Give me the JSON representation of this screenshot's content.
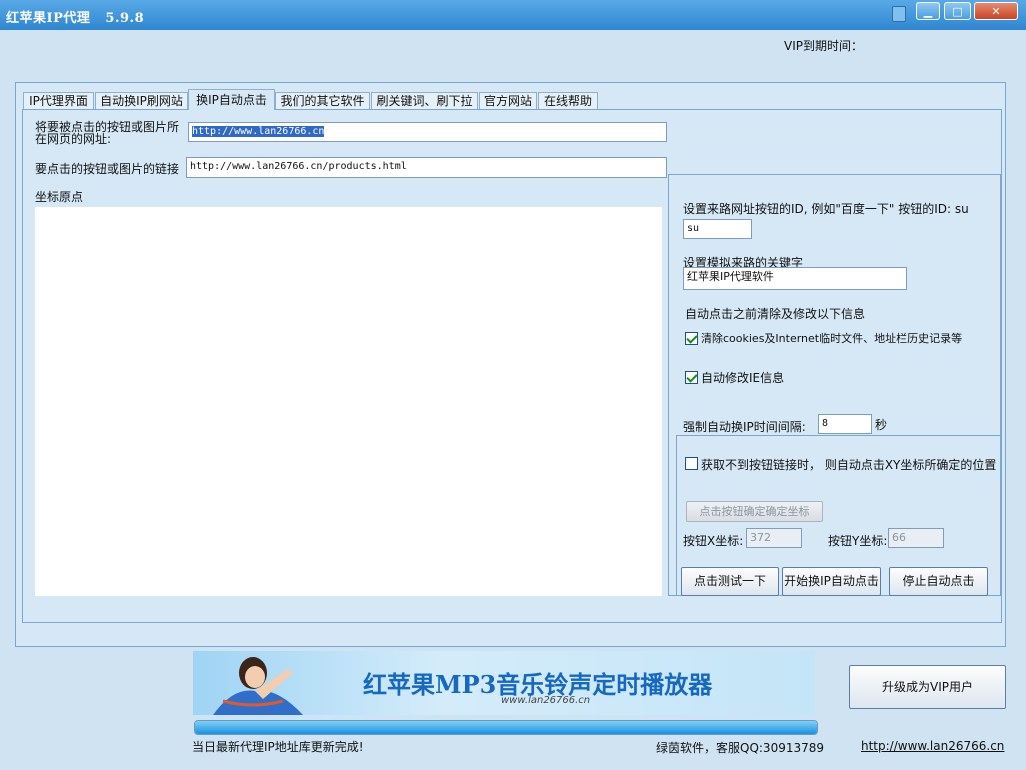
{
  "window": {
    "title": "红苹果IP代理   5.9.8",
    "minimize_glyph": "▁",
    "maximize_glyph": "□",
    "close_glyph": "✕"
  },
  "header": {
    "vip_expire_label": "VIP到期时间："
  },
  "tabs": [
    {
      "label": "IP代理界面"
    },
    {
      "label": "自动换IP刷网站"
    },
    {
      "label": "换IP自动点击",
      "active": true
    },
    {
      "label": "我们的其它软件"
    },
    {
      "label": "刷关键词、刷下拉"
    },
    {
      "label": "官方网站"
    },
    {
      "label": "在线帮助"
    }
  ],
  "form": {
    "target_page_label": "将要被点击的按钮或图片所在网页的网址:",
    "target_page_url": "http://www.lan26766.cn",
    "click_link_label": "要点击的按钮或图片的链接",
    "click_link_url": "http://www.lan26766.cn/products.html",
    "origin_label": "坐标原点"
  },
  "right_panel": {
    "referrer_id_label": "设置来路网址按钮的ID, 例如\"百度一下\" 按钮的ID: su",
    "referrer_id_value": "su",
    "keyword_label": "设置模拟来路的关键字",
    "keyword_value": "红苹果IP代理软件",
    "clear_info_label": "自动点击之前清除及修改以下信息",
    "clear_cookies_label": "清除cookies及Internet临时文件、地址栏历史记录等",
    "clear_cookies_checked": true,
    "modify_ie_label": "自动修改IE信息",
    "modify_ie_checked": true,
    "interval_label": "强制自动换IP时间间隔:",
    "interval_value": "8",
    "interval_unit": "秒",
    "fallback_xy_label": "获取不到按钮链接时， 则自动点击XY坐标所确定的位置",
    "fallback_xy_checked": false,
    "determine_coord_button": "点击按钮确定确定坐标",
    "x_label": "按钮X坐标:",
    "x_value": "372",
    "y_label": "按钮Y坐标:",
    "y_value": "66",
    "test_button": "点击测试一下",
    "start_button": "开始换IP自动点击",
    "stop_button": "停止自动点击"
  },
  "banner": {
    "title": "红苹果MP3音乐铃声定时播放器",
    "url": "www.lan26766.cn"
  },
  "vip_button": "升级成为VIP用户",
  "progress": {
    "fraction": 1.0
  },
  "status": {
    "message": "当日最新代理IP地址库更新完成!",
    "support": "绿茵软件，客服QQ:30913789",
    "website": "http://www.lan26766.cn"
  },
  "colors": {
    "titlebar": "#3a90d8",
    "background": "#cfe3f3",
    "banner_title": "#1668c0"
  },
  "icons": {
    "tray": "shopping-bag-icon",
    "checkbox_on": "checkmark-icon"
  }
}
